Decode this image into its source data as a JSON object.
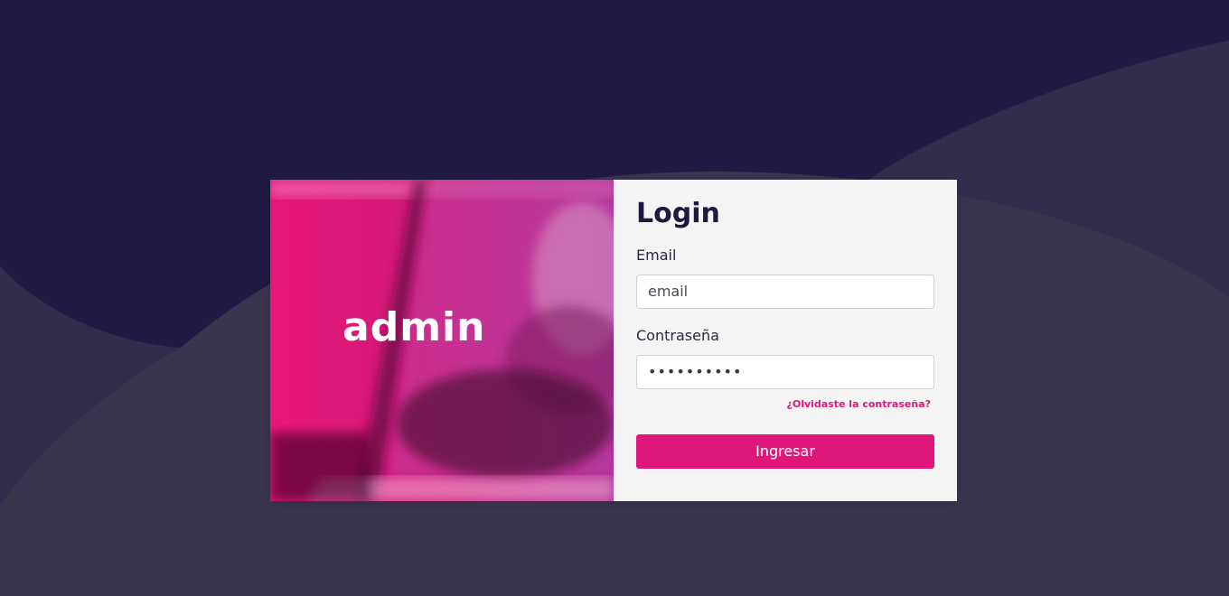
{
  "colors": {
    "background_dark": "#211a44",
    "background_light": "#3a344d",
    "accent": "#e0177b",
    "form_background": "#f4f4f4",
    "title_color": "#1e1a3d"
  },
  "hero": {
    "logo_text": "admin"
  },
  "login": {
    "title": "Login",
    "email_label": "Email",
    "email_placeholder": "email",
    "password_label": "Contraseña",
    "password_value": "••••••••••",
    "forgot_link": "¿Olvidaste la contraseña?",
    "submit_label": "Ingresar"
  }
}
